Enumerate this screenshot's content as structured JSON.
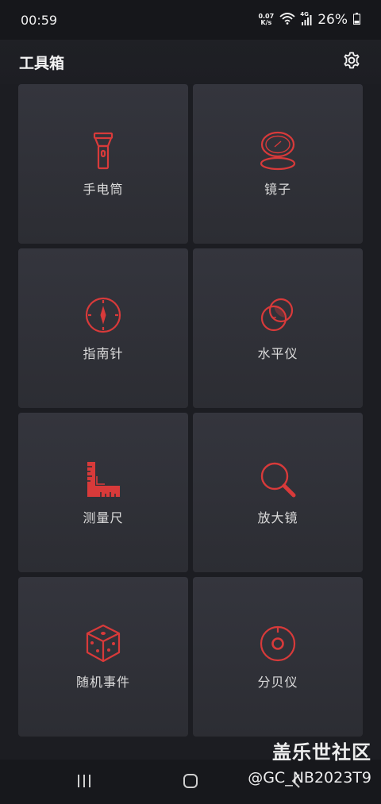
{
  "status_bar": {
    "time": "00:59",
    "net_speed_value": "0.07",
    "net_speed_unit": "K/s",
    "wifi_icon": "wifi-icon",
    "signal_label": "4G",
    "battery_percent": "26%"
  },
  "app": {
    "title": "工具箱",
    "settings_icon": "gear-icon"
  },
  "tools": [
    {
      "label": "手电筒",
      "icon": "flashlight-icon"
    },
    {
      "label": "镜子",
      "icon": "mirror-icon"
    },
    {
      "label": "指南针",
      "icon": "compass-icon"
    },
    {
      "label": "水平仪",
      "icon": "level-icon"
    },
    {
      "label": "测量尺",
      "icon": "ruler-icon"
    },
    {
      "label": "放大镜",
      "icon": "magnifier-icon"
    },
    {
      "label": "随机事件",
      "icon": "dice-icon"
    },
    {
      "label": "分贝仪",
      "icon": "decibel-icon"
    }
  ],
  "nav": {
    "recents_icon": "recents-icon",
    "home_icon": "home-icon",
    "back_icon": "back-icon"
  },
  "watermark": {
    "line1": "盖乐世社区",
    "line2": "@GC_NB2023T9"
  },
  "colors": {
    "accent": "#d83a3a",
    "tile_top": "#34353d",
    "tile_bottom": "#2c2d33",
    "background": "#1c1d22"
  }
}
